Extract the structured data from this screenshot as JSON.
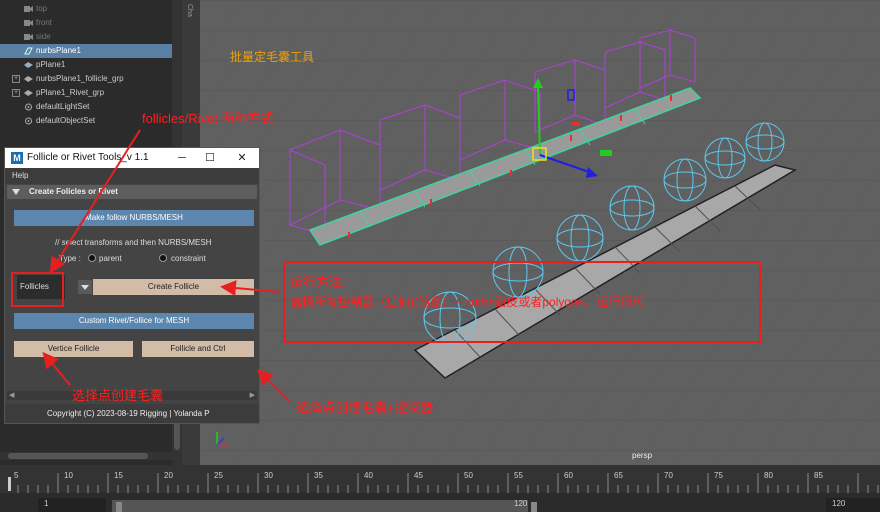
{
  "outliner": {
    "items": [
      {
        "label": "top",
        "dim": true,
        "icon": "camera-icon"
      },
      {
        "label": "front",
        "dim": true,
        "icon": "camera-icon"
      },
      {
        "label": "side",
        "dim": true,
        "icon": "camera-icon"
      },
      {
        "label": "nurbsPlane1",
        "selected": true,
        "icon": "nurbs-icon"
      },
      {
        "label": "pPlane1",
        "icon": "mesh-icon"
      },
      {
        "label": "nurbsPlane1_follicle_grp",
        "expandable": true,
        "icon": "group-icon"
      },
      {
        "label": "pPlane1_Rivet_grp",
        "expandable": true,
        "icon": "group-icon"
      },
      {
        "label": "defaultLightSet",
        "icon": "set-icon"
      },
      {
        "label": "defaultObjectSet",
        "icon": "set-icon"
      }
    ]
  },
  "side_strip": {
    "label": "Cha"
  },
  "viewport": {
    "camera_label": "persp"
  },
  "timeline": {
    "ticks": [
      "5",
      "10",
      "15",
      "20",
      "25",
      "30",
      "35",
      "40",
      "45",
      "50",
      "55",
      "60",
      "65",
      "70",
      "75",
      "80",
      "85",
      "90",
      "95",
      "100"
    ]
  },
  "range": {
    "start": "1",
    "left": "1",
    "end_in_slider": "120",
    "right": "120"
  },
  "dialog": {
    "title": "Follicle or Rivet Tools_v 1.1",
    "minimize": "─",
    "maximize": "☐",
    "close": "✕",
    "menu_help": "Help",
    "frame_title": "Create Folicles or Rivet",
    "btn_make_follow": "Make follow NURBS/MESH",
    "hint": "// select transforms and then NURBS/MESH",
    "type_label": "Type :",
    "radio_parent": "parent",
    "radio_constraint": "constraint",
    "option_value": "Follicles",
    "btn_create_follicle": "Create Follicle",
    "btn_custom": "Custom Rivet/Follice for MESH",
    "btn_vertice": "Vertice Follicle",
    "btn_follicle_ctrl": "Follicle and Ctrl",
    "copyright": "Copyright (C)  2023-08-19 Rigging  | Yolanda P"
  },
  "annotations": {
    "title_tool": "批量定毛囊工具",
    "two_ways": "follicles/Rivet 两种方式",
    "usage_title": "运行方法：",
    "usage_body": "选择所有控制器（任何)(随意）+ nurbs面皮或者polygon，运行即可",
    "vertex_hair": "选择点创建毛囊",
    "vertex_hair_ctrl": "选择点创建毛囊+控制器"
  },
  "colors": {
    "annotation_red": "#ff2020",
    "annotation_orange": "#f0a000",
    "button_blue": "#5c86ad",
    "button_tan": "#d2bca8",
    "selection": "#5a7fa5"
  }
}
